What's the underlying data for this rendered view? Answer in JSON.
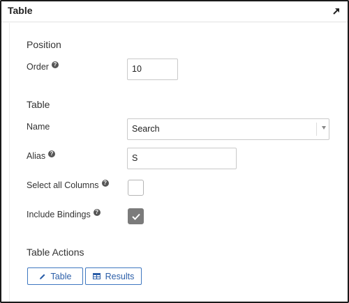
{
  "panel": {
    "title": "Table",
    "expand_icon": "arrow-up-right-icon"
  },
  "position_section": {
    "title": "Position",
    "order": {
      "label": "Order",
      "value": "10"
    }
  },
  "table_section": {
    "title": "Table",
    "name": {
      "label": "Name",
      "value": "Search"
    },
    "alias": {
      "label": "Alias",
      "value": "S"
    },
    "select_all_columns": {
      "label": "Select all Columns",
      "checked": false
    },
    "include_bindings": {
      "label": "Include Bindings",
      "checked": true
    }
  },
  "actions_section": {
    "title": "Table Actions",
    "buttons": [
      {
        "label": "Table",
        "icon": "pencil-icon"
      },
      {
        "label": "Results",
        "icon": "grid-table-icon"
      }
    ]
  },
  "help_glyph": "?",
  "colors": {
    "accent": "#2b5ea8",
    "border": "#3e77c0",
    "checked_fill": "#7b7b7b"
  }
}
